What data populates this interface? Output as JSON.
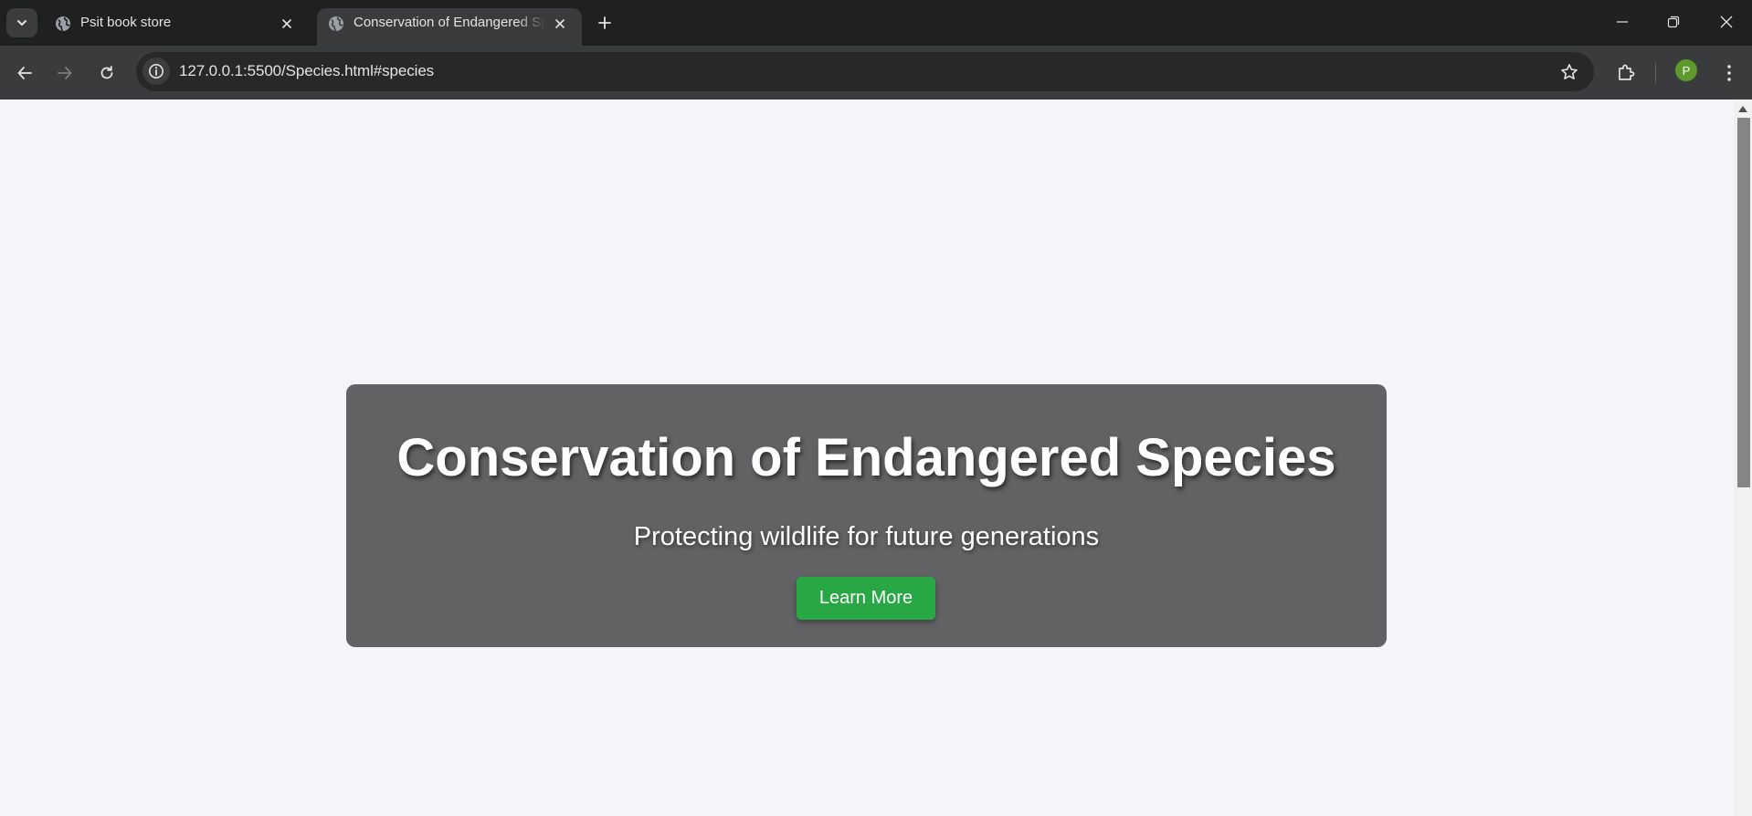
{
  "browser": {
    "tabs": [
      {
        "title": "Psit book store",
        "favicon": "globe-icon",
        "active": false
      },
      {
        "title": "Conservation of Endangered Species",
        "favicon": "globe-icon",
        "active": true
      }
    ],
    "address": {
      "url": "127.0.0.1:5500/Species.html#species"
    },
    "profile_initial": "P",
    "colors": {
      "tabstrip_bg": "#1f2020",
      "toolbar_bg": "#3a3b3c",
      "profile_bg": "#5c9a2b"
    }
  },
  "page": {
    "background": "#f4f4f9",
    "hero": {
      "title": "Conservation of Endangered Species",
      "subtitle": "Protecting wildlife for future generations",
      "button_label": "Learn More",
      "button_color": "#28a745",
      "card_color": "#626264"
    }
  }
}
